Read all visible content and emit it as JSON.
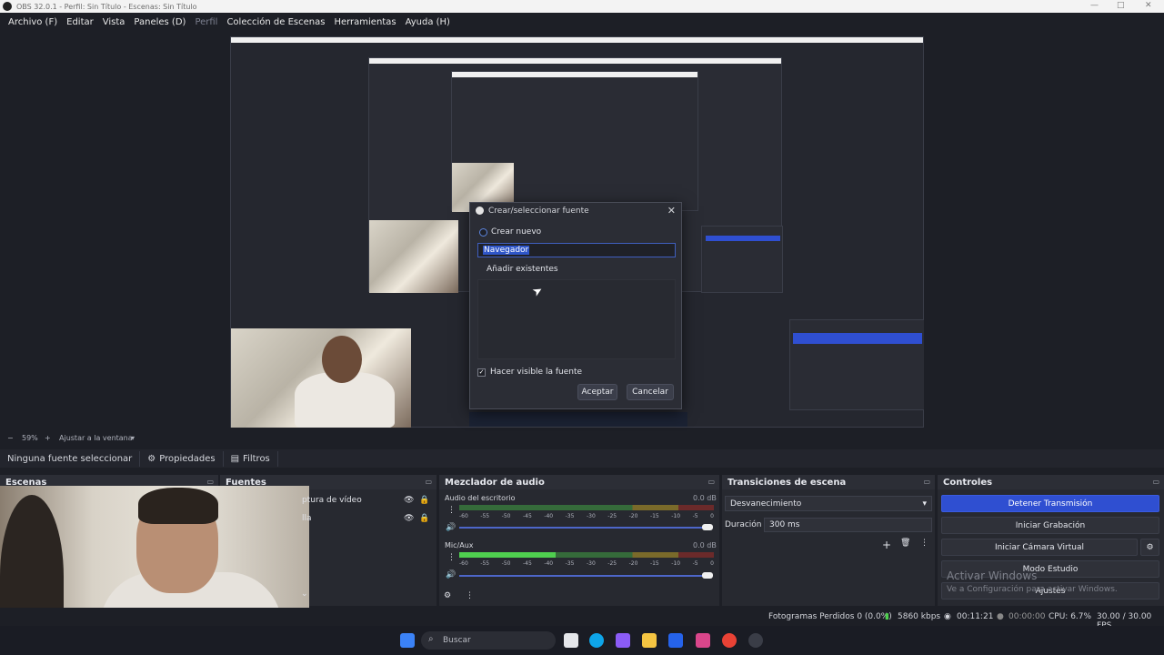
{
  "window": {
    "title": "OBS 32.0.1 - Perfil: Sin Título - Escenas: Sin Título"
  },
  "menu": {
    "items": [
      "Archivo (F)",
      "Editar",
      "Vista",
      "Paneles (D)",
      "Perfil",
      "Colección de Escenas",
      "Herramientas",
      "Ayuda (H)"
    ]
  },
  "dialog": {
    "title": "Crear/seleccionar fuente",
    "create_new_label": "Crear nuevo",
    "name_value": "Navegador",
    "add_existing_label": "Añadir existentes",
    "visible_label": "Hacer visible la fuente",
    "visible_checked": true,
    "accept_label": "Aceptar",
    "cancel_label": "Cancelar"
  },
  "zoom": {
    "value": "59%",
    "fit_label": "Ajustar a la ventana"
  },
  "source_toolbar": {
    "no_source_label": "Ninguna fuente seleccionar",
    "properties_label": "Propiedades",
    "filters_label": "Filtros"
  },
  "docks": {
    "scenes_title": "Escenas",
    "sources_title": "Fuentes",
    "sources": [
      "ptura de vídeo",
      "lla"
    ],
    "mixer_title": "Mezclador de audio",
    "mixer": [
      {
        "name": "Audio del escritorio",
        "db": "0.0 dB",
        "level": 0
      },
      {
        "name": "Mic/Aux",
        "db": "0.0 dB",
        "level": 0.38
      }
    ],
    "mixer_ticks": [
      "-60",
      "-55",
      "-50",
      "-45",
      "-40",
      "-35",
      "-30",
      "-25",
      "-20",
      "-15",
      "-10",
      "-5",
      "0"
    ],
    "transitions_title": "Transiciones de escena",
    "transition_value": "Desvanecimiento",
    "duration_label": "Duración",
    "duration_value": "300 ms",
    "controls_title": "Controles",
    "controls": {
      "stop_stream": "Detener Transmisión",
      "start_recording": "Iniciar Grabación",
      "start_virtual_cam": "Iniciar Cámara Virtual",
      "studio_mode": "Modo Estudio",
      "settings": "Ajustes"
    }
  },
  "watermark": {
    "line1": "Activar Windows",
    "line2": "Ve a Configuración para activar Windows."
  },
  "status": {
    "dropped_frames": "Fotogramas Perdidos 0 (0.0%)",
    "bitrate": "5860 kbps",
    "live_time": "00:11:21",
    "rec_time": "00:00:00",
    "cpu": "CPU: 6.7%",
    "fps": "30.00 / 30.00 FPS"
  },
  "taskbar": {
    "search_placeholder": "Buscar"
  },
  "colors": {
    "accent": "#2f4fd1",
    "meter_green": "#4fcf4f",
    "background": "#1d1f26"
  }
}
